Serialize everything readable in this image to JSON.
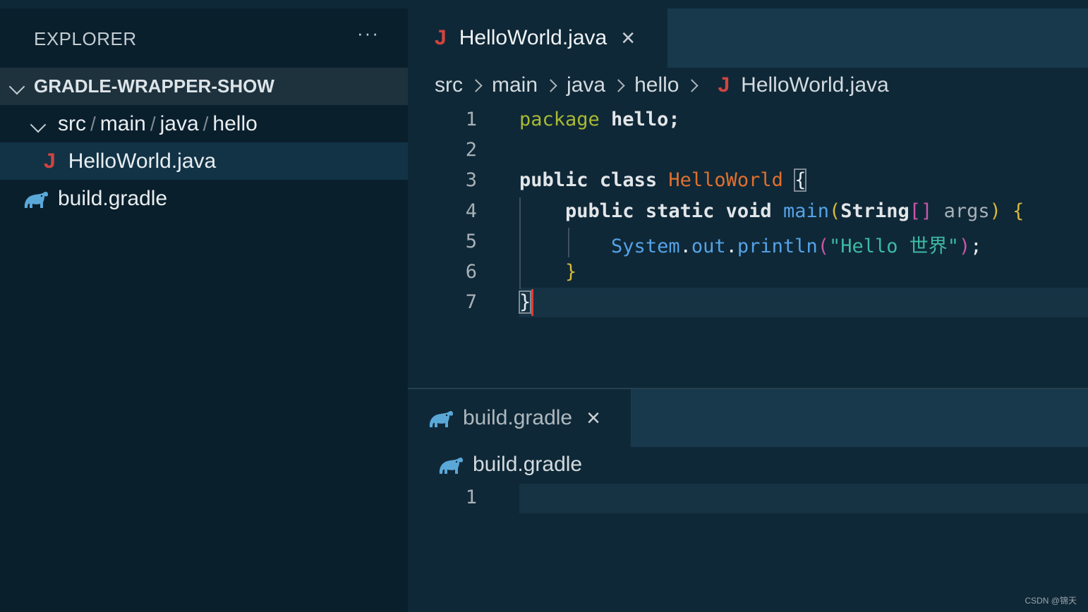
{
  "sidebar": {
    "title": "EXPLORER",
    "more_label": "···",
    "project": "GRADLE-WRAPPER-SHOW",
    "folder_path": [
      "src",
      "main",
      "java",
      "hello"
    ],
    "folder_sep": "/",
    "selected_file": "HelloWorld.java",
    "gradle_file": "build.gradle"
  },
  "editor1": {
    "tab_label": "HelloWorld.java",
    "tab_close": "×",
    "file_icon": "J",
    "breadcrumbs": [
      "src",
      "main",
      "java",
      "hello",
      "HelloWorld.java"
    ],
    "line_numbers": [
      "1",
      "2",
      "3",
      "4",
      "5",
      "6",
      "7"
    ],
    "code": {
      "l1_kw": "package",
      "l1_rest": " hello;",
      "l3_public": "public",
      "l3_class": "class",
      "l3_name": "HelloWorld",
      "l3_brace": "{",
      "l4_public": "public",
      "l4_static": "static",
      "l4_void": "void",
      "l4_main": "main",
      "l4_paren_open": "(",
      "l4_string": "String",
      "l4_arr": "[]",
      "l4_args": " args",
      "l4_paren_close": ")",
      "l4_brace": "{",
      "l5_system": "System",
      "l5_dot1": ".",
      "l5_out": "out",
      "l5_dot2": ".",
      "l5_println": "println",
      "l5_paren_open": "(",
      "l5_string": "\"Hello 世界\"",
      "l5_paren_close": ")",
      "l5_semi": ";",
      "l6_brace": "}",
      "l7_brace": "}"
    }
  },
  "editor2": {
    "tab_label": "build.gradle",
    "tab_close": "×",
    "breadcrumb": "build.gradle",
    "line_numbers": [
      "1"
    ]
  },
  "icons": {
    "java": "java-file-icon",
    "gradle": "gradle-elephant-icon",
    "chevron": "chevron-down-icon",
    "more": "more-actions-icon",
    "close": "close-icon"
  },
  "colors": {
    "background": "#0a1f2c",
    "editor_bg": "#0f2837",
    "java_icon": "#d2443f",
    "gradle_icon": "#5aa8d8"
  },
  "watermark": "CSDN @锦天"
}
